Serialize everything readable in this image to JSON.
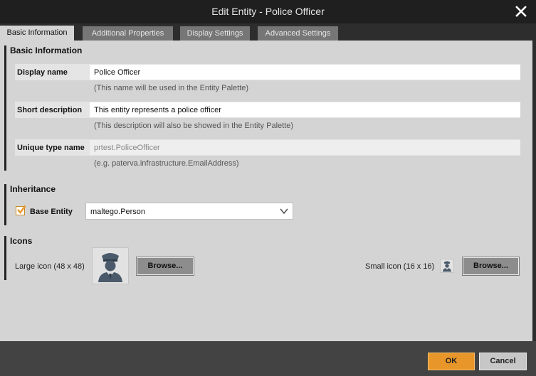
{
  "window": {
    "title": "Edit Entity - Police Officer",
    "close_icon": "close-icon"
  },
  "tabs": [
    {
      "label": "Basic Information",
      "active": true
    },
    {
      "label": "Additional Properties",
      "active": false
    },
    {
      "label": "Display Settings",
      "active": false
    },
    {
      "label": "Advanced Settings",
      "active": false
    }
  ],
  "basic": {
    "section_title": "Basic Information",
    "display_name": {
      "label": "Display name",
      "value": "Police Officer",
      "hint": "(This name will be used in the Entity Palette)"
    },
    "short_description": {
      "label": "Short description",
      "value": "This entity represents a police officer",
      "hint": "(This description will also be showed in the Entity Palette)"
    },
    "unique_type_name": {
      "label": "Unique type name",
      "value": "prtest.PoliceOfficer",
      "hint": "(e.g. paterva.infrastructure.EmailAddress)"
    }
  },
  "inheritance": {
    "section_title": "Inheritance",
    "base_entity_label": "Base Entity",
    "base_entity_checked": true,
    "base_entity_value": "maltego.Person"
  },
  "icons": {
    "section_title": "Icons",
    "large_label": "Large icon (48 x 48)",
    "small_label": "Small icon (16 x 16)",
    "browse_label": "Browse..."
  },
  "footer": {
    "ok_label": "OK",
    "cancel_label": "Cancel"
  },
  "colors": {
    "accent": "#e8962a",
    "titlebar": "#1f1f1f",
    "tab_inactive": "#767676",
    "panel": "#d4d4d4",
    "footer": "#434343"
  }
}
